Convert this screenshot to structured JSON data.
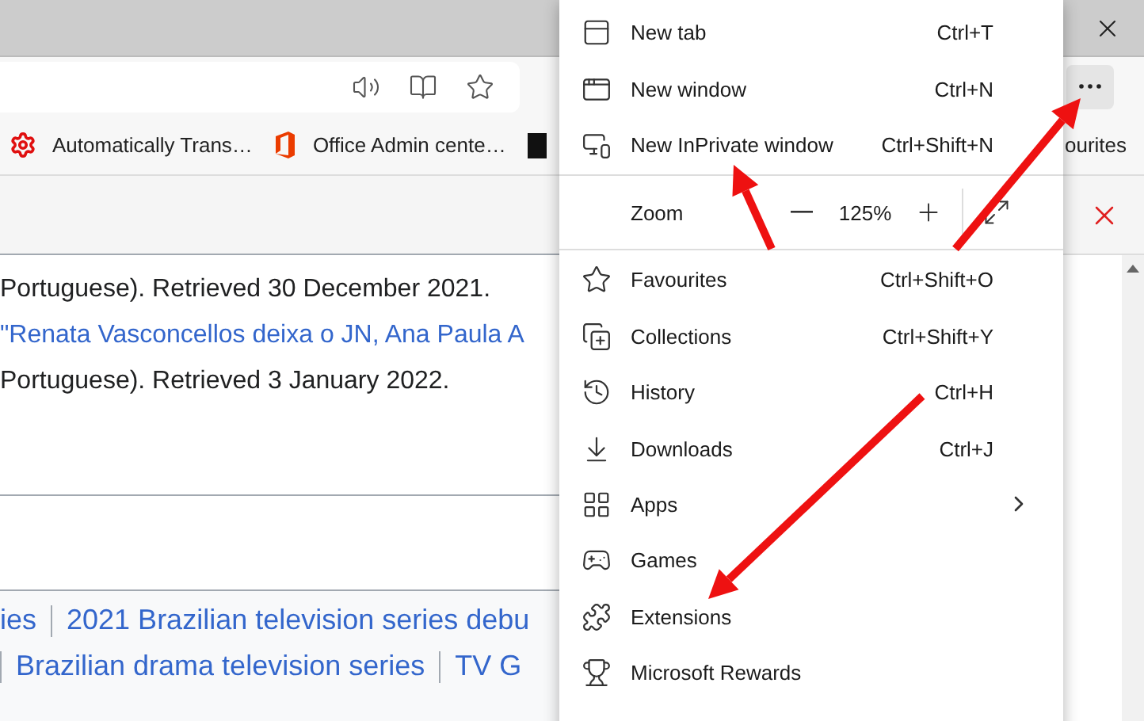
{
  "bookmarks": [
    {
      "label": "Automatically Trans…"
    },
    {
      "label": "Office Admin cente…"
    },
    {
      "label": "ourites"
    }
  ],
  "references": [
    {
      "kind": "plain",
      "text": "Portuguese). Retrieved 30 December 2021."
    },
    {
      "kind": "link",
      "text": "\"Renata Vasconcellos deixa o JN, Ana Paula A"
    },
    {
      "kind": "plain",
      "text": "Portuguese). Retrieved 3 January 2022."
    }
  ],
  "categories": [
    {
      "leading_separator": false,
      "items": [
        "ies",
        "2021 Brazilian television series debu"
      ]
    },
    {
      "leading_separator": true,
      "items": [
        "Brazilian drama television series",
        "TV G"
      ]
    }
  ],
  "menu": {
    "sections": [
      [
        {
          "kind": "item",
          "label": "New tab",
          "shortcut": "Ctrl+T"
        },
        {
          "kind": "item",
          "label": "New window",
          "shortcut": "Ctrl+N"
        },
        {
          "kind": "item",
          "label": "New InPrivate window",
          "shortcut": "Ctrl+Shift+N"
        }
      ],
      [
        {
          "kind": "zoom",
          "label": "Zoom",
          "value": "125%"
        }
      ],
      [
        {
          "kind": "item",
          "label": "Favourites",
          "shortcut": "Ctrl+Shift+O"
        },
        {
          "kind": "item",
          "label": "Collections",
          "shortcut": "Ctrl+Shift+Y"
        },
        {
          "kind": "item",
          "label": "History",
          "shortcut": "Ctrl+H"
        },
        {
          "kind": "item",
          "label": "Downloads",
          "shortcut": "Ctrl+J"
        },
        {
          "kind": "item",
          "label": "Apps",
          "submenu": true
        },
        {
          "kind": "item",
          "label": "Games"
        },
        {
          "kind": "item",
          "label": "Extensions"
        },
        {
          "kind": "item",
          "label": "Microsoft Rewards"
        }
      ]
    ]
  }
}
